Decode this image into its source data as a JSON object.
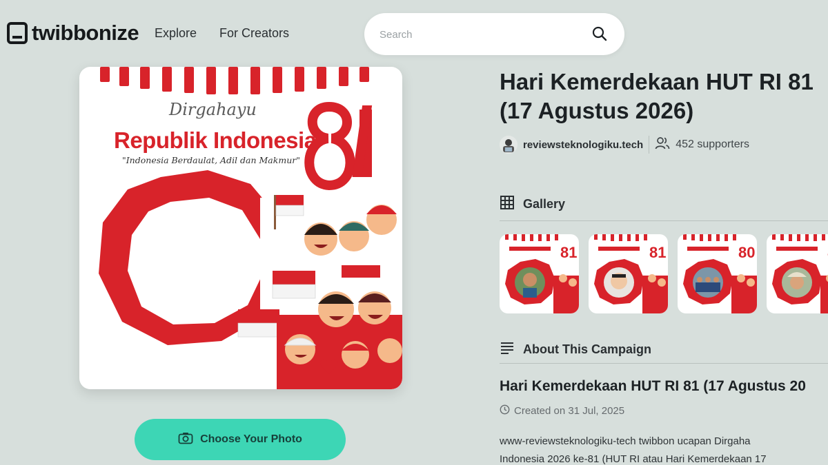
{
  "header": {
    "logo_text": "twibbonize",
    "nav": {
      "explore": "Explore",
      "for_creators": "For Creators"
    },
    "search_placeholder": "Search"
  },
  "twibbon": {
    "dirgahayu": "Dirgahayu",
    "republik": "Republik Indonesia",
    "motto": "\"Indonesia Berdaulat, Adil dan Makmur\"",
    "anniversary": "81"
  },
  "actions": {
    "choose_photo": "Choose Your Photo"
  },
  "campaign": {
    "title_line1": "Hari Kemerdekaan HUT RI 81",
    "title_line2": "(17 Agustus 2026)",
    "creator": "reviewsteknologiku.tech",
    "supporters": "452 supporters"
  },
  "gallery": {
    "label": "Gallery",
    "thumb_count": 4
  },
  "about": {
    "label": "About This Campaign",
    "title": "Hari Kemerdekaan HUT RI 81 (17 Agustus 20",
    "created": "Created on 31 Jul, 2025",
    "desc_line1": "www-reviewsteknologiku-tech twibbon ucapan Dirgaha",
    "desc_line2": "Indonesia 2026 ke-81 (HUT RI atau Hari Kemerdekaan 17"
  },
  "colors": {
    "accent": "#3dd6b5",
    "brand_red": "#d8232a",
    "background": "#d7dfdc"
  }
}
